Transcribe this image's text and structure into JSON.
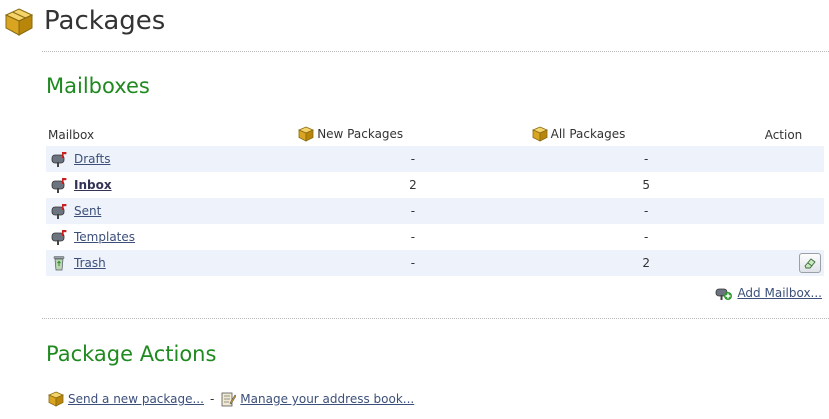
{
  "header": {
    "title": "Packages",
    "icon": "package-icon"
  },
  "mailboxes_section": {
    "heading": "Mailboxes",
    "columns": {
      "mailbox": "Mailbox",
      "new_packages": "New Packages",
      "all_packages": "All Packages",
      "action": "Action"
    },
    "rows": [
      {
        "name": "Drafts",
        "new": "-",
        "all": "-",
        "icon": "mailbox-icon",
        "bold": false,
        "has_action": false
      },
      {
        "name": "Inbox",
        "new": "2",
        "all": "5",
        "icon": "mailbox-icon",
        "bold": true,
        "has_action": false
      },
      {
        "name": "Sent",
        "new": "-",
        "all": "-",
        "icon": "mailbox-icon",
        "bold": false,
        "has_action": false
      },
      {
        "name": "Templates",
        "new": "-",
        "all": "-",
        "icon": "mailbox-icon",
        "bold": false,
        "has_action": false
      },
      {
        "name": "Trash",
        "new": "-",
        "all": "2",
        "icon": "trash-icon",
        "bold": false,
        "has_action": true
      }
    ],
    "add_mailbox_label": "Add Mailbox..."
  },
  "package_actions_section": {
    "heading": "Package Actions",
    "send_label": "Send a new package...",
    "separator": "-",
    "address_book_label": "Manage your address book..."
  },
  "colors": {
    "heading_green": "#1f8a1f",
    "link": "#3c4f7a",
    "row_alt": "#eef2fb",
    "package_gold": "#d9a520"
  }
}
